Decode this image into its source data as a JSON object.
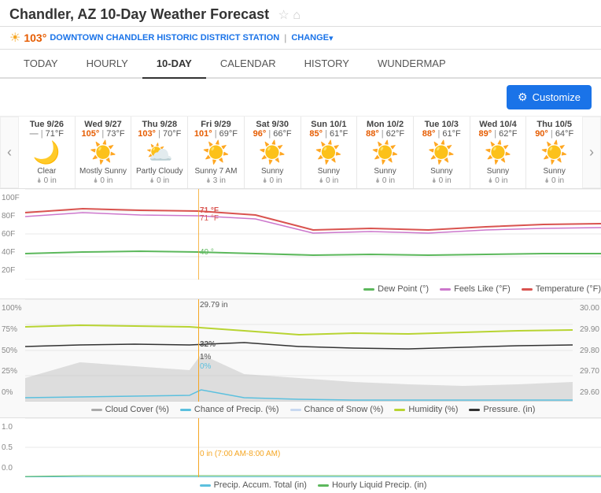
{
  "page": {
    "title": "Chandler, AZ 10-Day Weather Forecast",
    "station_temp": "103°",
    "station_name": "DOWNTOWN CHANDLER HISTORIC DISTRICT STATION",
    "change_label": "CHANGE",
    "tabs": [
      "TODAY",
      "HOURLY",
      "10-DAY",
      "CALENDAR",
      "HISTORY",
      "WUNDERMAP"
    ],
    "active_tab": "10-DAY",
    "customize_label": "Customize"
  },
  "days": [
    {
      "name": "Tue",
      "date": "9/26",
      "high": "—",
      "low": "71°F",
      "icon": "🌙",
      "desc": "Clear",
      "precip": "0 in",
      "is_today": true
    },
    {
      "name": "Wed",
      "date": "9/27",
      "high": "105°",
      "low": "73°F",
      "icon": "☀️",
      "desc": "Mostly Sunny",
      "precip": "0 in"
    },
    {
      "name": "Thu",
      "date": "9/28",
      "high": "103°",
      "low": "70°F",
      "icon": "⛅",
      "desc": "Partly Cloudy",
      "precip": "0 in"
    },
    {
      "name": "Fri",
      "date": "9/29",
      "high": "101°",
      "low": "69°F",
      "icon": "☀️",
      "desc": "Sunny 7 AM",
      "precip": "3 in"
    },
    {
      "name": "Sat",
      "date": "9/30",
      "high": "96°",
      "low": "66°F",
      "icon": "☀️",
      "desc": "Sunny",
      "precip": "0 in"
    },
    {
      "name": "Sun",
      "date": "10/1",
      "high": "85°",
      "low": "61°F",
      "icon": "☀️",
      "desc": "Sunny",
      "precip": "0 in"
    },
    {
      "name": "Mon",
      "date": "10/2",
      "high": "88°",
      "low": "62°F",
      "icon": "☀️",
      "desc": "Sunny",
      "precip": "0 in"
    },
    {
      "name": "Tue",
      "date": "10/3",
      "high": "88°",
      "low": "61°F",
      "icon": "☀️",
      "desc": "Sunny",
      "precip": "0 in"
    },
    {
      "name": "Wed",
      "date": "10/4",
      "high": "89°",
      "low": "62°F",
      "icon": "☀️",
      "desc": "Sunny",
      "precip": "0 in"
    },
    {
      "name": "Thu",
      "date": "10/5",
      "high": "90°",
      "low": "64°F",
      "icon": "☀️",
      "desc": "Sunny",
      "precip": "0 in"
    }
  ],
  "chart1": {
    "y_labels": [
      "100 F",
      "80 F",
      "60 F",
      "40 F",
      "20 F"
    ],
    "callouts": [
      {
        "text": "71 °F",
        "color": "#d9534f"
      },
      {
        "text": "71 °F",
        "color": "#d9534f"
      },
      {
        "text": "40 °",
        "color": "#5cb85c"
      }
    ],
    "legend": [
      {
        "label": "Dew Point (°)",
        "color": "#5cb85c"
      },
      {
        "label": "Feels Like (°F)",
        "color": "#cc77cc"
      },
      {
        "label": "Temperature (°F)",
        "color": "#d9534f"
      }
    ]
  },
  "chart2": {
    "y_labels_left": [
      "100%",
      "75%",
      "50%",
      "25%",
      "0%"
    ],
    "y_labels_right": [
      "30.00",
      "29.90",
      "29.80",
      "29.70",
      "29.60"
    ],
    "callouts": [
      {
        "text": "29.79 in"
      },
      {
        "text": "32%"
      },
      {
        "text": "1%"
      },
      {
        "text": "0%"
      }
    ],
    "legend": [
      {
        "label": "Cloud Cover (%)",
        "color": "#aaa"
      },
      {
        "label": "Chance of Precip. (%)",
        "color": "#5bc0de"
      },
      {
        "label": "Chance of Snow (%)",
        "color": "#c8d8f0"
      },
      {
        "label": "Humidity (%)",
        "color": "#b8d432"
      },
      {
        "label": "Pressure. (in)",
        "color": "#333"
      }
    ]
  },
  "chart3": {
    "y_labels": [
      "1.0",
      "0.5",
      "0.0"
    ],
    "callout": "0 in (7:00 AM-8:00 AM)",
    "legend": [
      {
        "label": "Precip. Accum. Total (in)",
        "color": "#5bc0de"
      },
      {
        "label": "Hourly Liquid Precip. (in)",
        "color": "#5cb85c"
      }
    ]
  }
}
